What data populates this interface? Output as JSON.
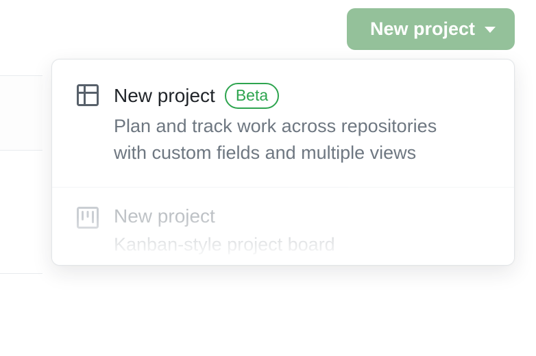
{
  "button": {
    "label": "New project"
  },
  "menu": {
    "items": [
      {
        "title": "New project",
        "badge": "Beta",
        "description": "Plan and track work across repositories with custom fields and multiple views"
      },
      {
        "title": "New project",
        "description": "Kanban-style project board"
      }
    ]
  }
}
